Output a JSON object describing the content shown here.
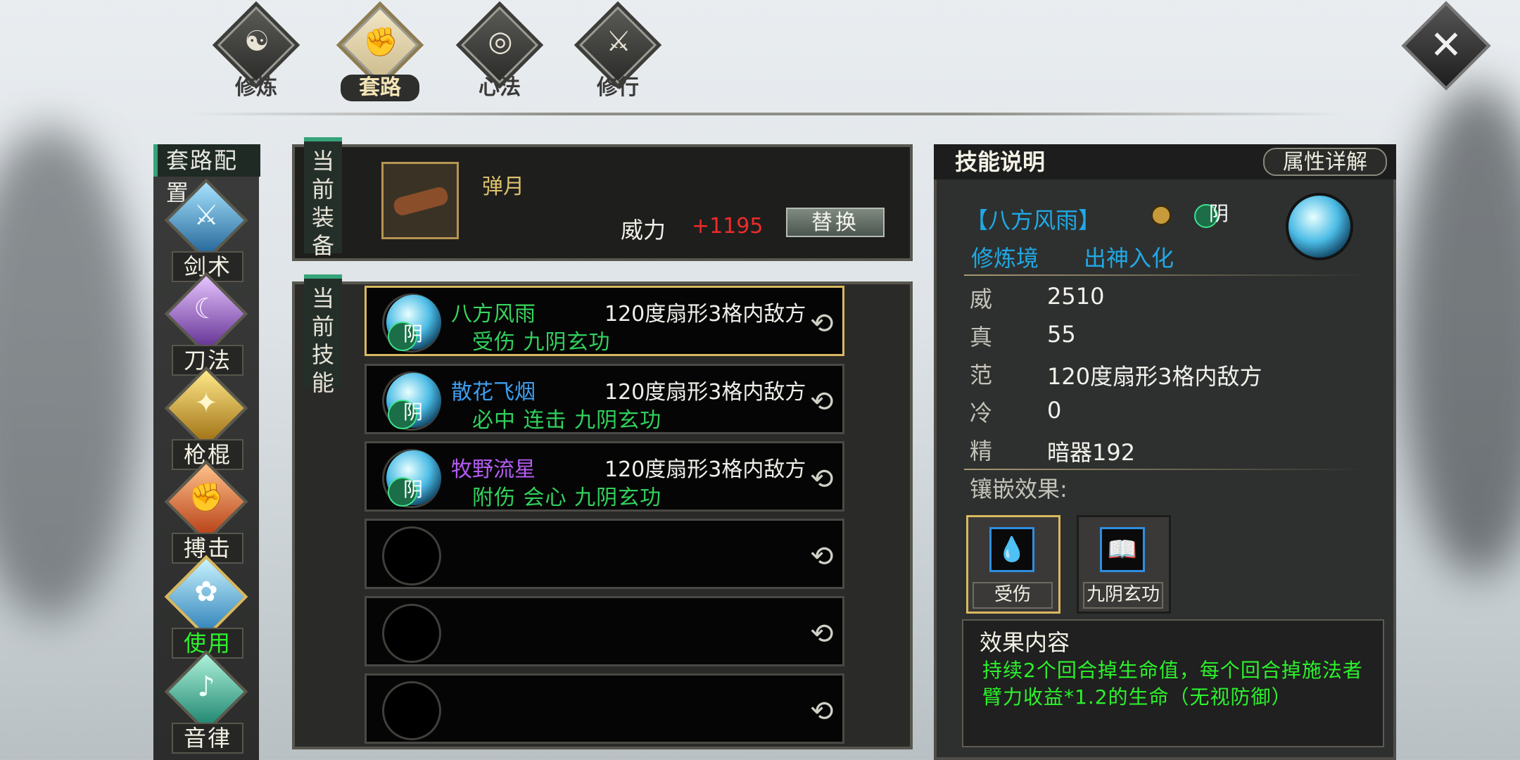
{
  "top_tabs": [
    {
      "label": "修炼",
      "glyph": "☯"
    },
    {
      "label": "套路",
      "glyph": "✊"
    },
    {
      "label": "心法",
      "glyph": "◎"
    },
    {
      "label": "修行",
      "glyph": "⚔"
    }
  ],
  "close_glyph": "✕",
  "sidebar": {
    "title": "套路配置",
    "categories": [
      {
        "label": "剑术",
        "glyph": "⚔"
      },
      {
        "label": "刀法",
        "glyph": "☾"
      },
      {
        "label": "枪棍",
        "glyph": "✦"
      },
      {
        "label": "搏击",
        "glyph": "✊"
      },
      {
        "label": "使用中",
        "glyph": "✿"
      },
      {
        "label": "音律",
        "glyph": "♪"
      }
    ]
  },
  "equip": {
    "tag": "当前装备",
    "name": "弹月",
    "power_label": "威力",
    "power_value": "+1195",
    "replace_label": "替换"
  },
  "skills": {
    "tag": "当前技能",
    "yin": "阴",
    "swap_glyph": "⟲",
    "items": [
      {
        "name": "八方风雨",
        "range": "120度扇形3格内敌方",
        "tags": "受伤 九阴玄功",
        "color": "#37d45e"
      },
      {
        "name": "散花飞烟",
        "range": "120度扇形3格内敌方",
        "tags": "必中 连击 九阴玄功",
        "color": "#3e9ff0"
      },
      {
        "name": "牧野流星",
        "range": "120度扇形3格内敌方",
        "tags": "附伤 会心 九阴玄功",
        "color": "#b45cf0"
      }
    ]
  },
  "detail": {
    "title": "技能说明",
    "attr_button": "属性详解",
    "skill_name": "【八方风雨】",
    "yin": "阴",
    "realm_label": "修炼境",
    "realm_value": "出神入化",
    "stats": [
      {
        "k": "威",
        "v": "2510"
      },
      {
        "k": "真",
        "v": "55"
      },
      {
        "k": "范",
        "v": "120度扇形3格内敌方"
      },
      {
        "k": "冷",
        "v": "0"
      },
      {
        "k": "精",
        "v": "暗器192"
      }
    ],
    "inlay_title": "镶嵌效果:",
    "inlays": [
      {
        "label": "受伤",
        "glyph": "💧"
      },
      {
        "label": "九阴玄功",
        "glyph": "📖"
      }
    ],
    "effect_title": "效果内容",
    "effect_text": "持续2个回合掉生命值，每个回合掉施法者臂力收益*1.2的生命（无视防御）"
  }
}
